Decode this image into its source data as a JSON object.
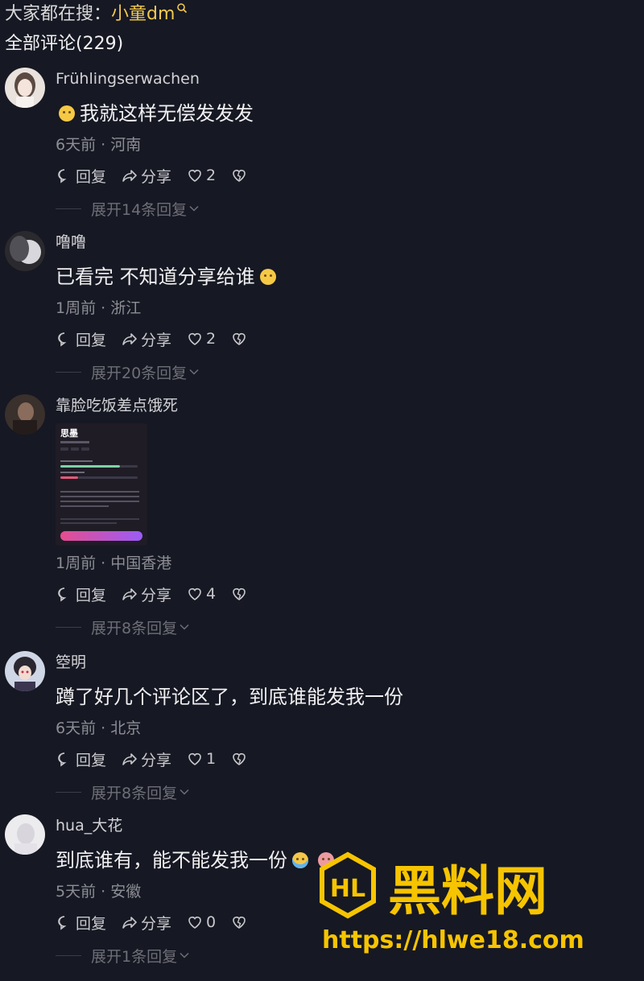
{
  "header": {
    "search_prefix": "大家都在搜：",
    "search_term": "小童dm",
    "comment_count": "全部评论(229)"
  },
  "labels": {
    "reply": "回复",
    "share": "分享"
  },
  "comments": [
    {
      "username": "Frühlingserwachen",
      "text": "我就这样无偿发发发",
      "meta": "6天前 · 河南",
      "likes": "2",
      "expand": "展开14条回复"
    },
    {
      "username": "噜噜",
      "text": "已看完 不知道分享给谁",
      "meta": "1周前 · 浙江",
      "likes": "2",
      "expand": "展开20条回复"
    },
    {
      "username": "靠脸吃饭差点饿死",
      "text": "",
      "meta": "1周前 · 中国香港",
      "likes": "4",
      "expand": "展开8条回复",
      "image": {
        "title": "思墨"
      }
    },
    {
      "username": "箜明",
      "text": "蹲了好几个评论区了，到底谁能发我一份",
      "meta": "6天前 · 北京",
      "likes": "1",
      "expand": "展开8条回复"
    },
    {
      "username": "hua_大花",
      "text": "到底谁有，能不能发我一份",
      "meta": "5天前 · 安徽",
      "likes": "0",
      "expand": "展开1条回复"
    }
  ],
  "watermark": {
    "logo": "HL",
    "name": "黑料网",
    "url": "https://hlwe18.com"
  },
  "colors": {
    "background": "#161823",
    "search_accent": "#f2c94c",
    "watermark": "#f6c400"
  }
}
